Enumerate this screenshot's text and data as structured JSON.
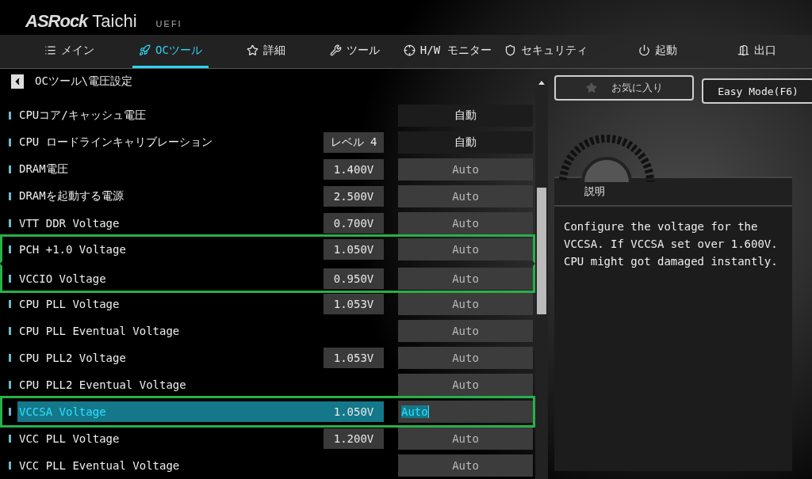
{
  "header": {
    "brand": "ASRock",
    "model": "Taichi",
    "firmware": "UEFI"
  },
  "tabs": [
    {
      "label": "メイン",
      "selected": false
    },
    {
      "label": "OCツール",
      "selected": true
    },
    {
      "label": "詳細",
      "selected": false
    },
    {
      "label": "ツール",
      "selected": false
    },
    {
      "label": "H/W モニター",
      "selected": false
    },
    {
      "label": "セキュリティ",
      "selected": false
    },
    {
      "label": "起動",
      "selected": false
    },
    {
      "label": "出口",
      "selected": false
    }
  ],
  "breadcrumb": "OCツール\\電圧設定",
  "buttons": {
    "favorites": "お気に入り",
    "easy_mode": "Easy Mode(F6)"
  },
  "settings": [
    {
      "name": "CPUコア/キャッシュ電圧",
      "value": "自動",
      "kind": "dropdown",
      "selected": false,
      "highlighted": false
    },
    {
      "name": "CPU ロードラインキャリブレーション",
      "reading": "レベル 4",
      "value": "自動",
      "kind": "dropdown",
      "selected": false,
      "highlighted": false
    },
    {
      "name": "DRAM電圧",
      "reading": "1.400V",
      "value": "Auto",
      "kind": "field",
      "selected": false,
      "highlighted": false
    },
    {
      "name": "DRAMを起動する電源",
      "reading": "2.500V",
      "value": "Auto",
      "kind": "field",
      "selected": false,
      "highlighted": false
    },
    {
      "name": "VTT DDR Voltage",
      "reading": "0.700V",
      "value": "Auto",
      "kind": "field",
      "selected": false,
      "highlighted": false
    },
    {
      "name": "PCH +1.0 Voltage",
      "reading": "1.050V",
      "value": "Auto",
      "kind": "field",
      "selected": false,
      "highlighted": true
    },
    {
      "name": "VCCIO Voltage",
      "reading": "0.950V",
      "value": "Auto",
      "kind": "field",
      "selected": false,
      "highlighted": true
    },
    {
      "name": "CPU PLL Voltage",
      "reading": "1.053V",
      "value": "Auto",
      "kind": "field",
      "selected": false,
      "highlighted": false
    },
    {
      "name": "CPU PLL Eventual Voltage",
      "value": "Auto",
      "kind": "field",
      "selected": false,
      "highlighted": false
    },
    {
      "name": "CPU PLL2 Voltage",
      "reading": "1.053V",
      "value": "Auto",
      "kind": "field",
      "selected": false,
      "highlighted": false
    },
    {
      "name": "CPU PLL2 Eventual Voltage",
      "value": "Auto",
      "kind": "field",
      "selected": false,
      "highlighted": false
    },
    {
      "name": "VCCSA Voltage",
      "reading": "1.050V",
      "value": "Auto",
      "kind": "field",
      "selected": true,
      "highlighted": true
    },
    {
      "name": "VCC PLL Voltage",
      "reading": "1.200V",
      "value": "Auto",
      "kind": "field",
      "selected": false,
      "highlighted": false
    },
    {
      "name": "VCC PLL Eventual Voltage",
      "value": "Auto",
      "kind": "field",
      "selected": false,
      "highlighted": false
    }
  ],
  "description": {
    "title": "説明",
    "text": "Configure the voltage for the VCCSA. If VCCSA set over 1.600V. CPU might got damaged instantly."
  }
}
